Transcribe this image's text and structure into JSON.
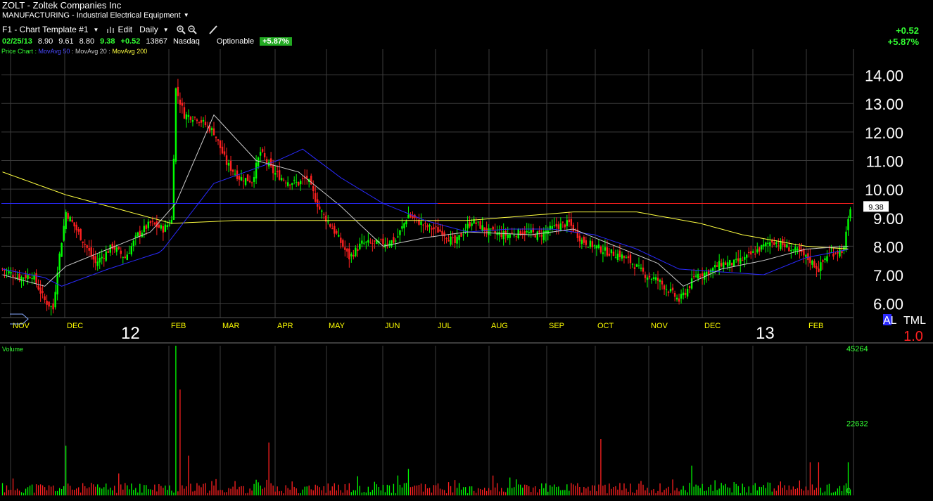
{
  "header": {
    "title": "ZOLT - Zoltek Companies Inc",
    "sector": "MANUFACTURING - Industrial Electrical Equipment",
    "toolbar": {
      "template": "F1 - Chart Template #1",
      "edit": "Edit",
      "period": "Daily"
    },
    "quote": {
      "date": "02/25/13",
      "open": "8.90",
      "high": "9.61",
      "low": "8.80",
      "last": "9.38",
      "change": "+0.52",
      "volume": "13867",
      "exchange": "Nasdaq",
      "optionable": "Optionable",
      "pct": "+5.87%"
    },
    "right_change": "+0.52",
    "right_pct": "+5.87%"
  },
  "legend": {
    "price_chart": "Price Chart :",
    "ma50": "MovAvg 50",
    "ma20": "MovAvg 20",
    "ma200": "MovAvg 200"
  },
  "colors": {
    "up": "#00ff00",
    "down": "#ff2020",
    "ma50": "#2a2aff",
    "ma20": "#c8c8c8",
    "ma200": "#ffff40",
    "grid": "#3c3c3c",
    "hline": "#2a2aff",
    "resist": "#ff2020",
    "axis_text": "#ffffff",
    "month_text": "#ffff00",
    "vol_label": "#33ff33"
  },
  "chart_data": [
    {
      "type": "candlestick",
      "title": "",
      "ylim": [
        5.5,
        14.9
      ],
      "yticks": [
        "14.00",
        "13.00",
        "12.00",
        "11.00",
        "10.00",
        "9.00",
        "8.00",
        "7.00",
        "6.00"
      ],
      "last_price_label": "9.38",
      "resistance_level": 9.5,
      "months": [
        "NOV",
        "DEC",
        "FEB",
        "MAR",
        "APR",
        "MAY",
        "JUN",
        "JUL",
        "AUG",
        "SEP",
        "OCT",
        "NOV",
        "DEC",
        "FEB"
      ],
      "years": [
        "12",
        "13"
      ],
      "corner_labels": {
        "al": "AL",
        "tml": "TML",
        "scale": "1.0"
      },
      "anchors": [
        [
          0,
          7.2
        ],
        [
          8,
          6.9
        ],
        [
          14,
          7.0
        ],
        [
          20,
          6.1
        ],
        [
          24,
          5.8
        ],
        [
          26,
          7.2
        ],
        [
          30,
          9.2
        ],
        [
          38,
          8.2
        ],
        [
          44,
          7.4
        ],
        [
          52,
          8.0
        ],
        [
          58,
          7.6
        ],
        [
          64,
          8.4
        ],
        [
          70,
          8.8
        ],
        [
          76,
          8.6
        ],
        [
          80,
          8.9
        ],
        [
          82,
          13.5
        ],
        [
          86,
          12.6
        ],
        [
          92,
          12.5
        ],
        [
          100,
          12.0
        ],
        [
          106,
          10.9
        ],
        [
          112,
          10.4
        ],
        [
          118,
          10.3
        ],
        [
          122,
          11.3
        ],
        [
          128,
          10.6
        ],
        [
          134,
          10.3
        ],
        [
          140,
          10.2
        ],
        [
          144,
          10.4
        ],
        [
          150,
          9.3
        ],
        [
          158,
          8.4
        ],
        [
          164,
          7.6
        ],
        [
          170,
          8.1
        ],
        [
          178,
          8.1
        ],
        [
          186,
          8.2
        ],
        [
          192,
          9.1
        ],
        [
          200,
          8.7
        ],
        [
          208,
          8.5
        ],
        [
          214,
          8.1
        ],
        [
          222,
          8.9
        ],
        [
          230,
          8.5
        ],
        [
          238,
          8.4
        ],
        [
          246,
          8.5
        ],
        [
          254,
          8.4
        ],
        [
          262,
          8.7
        ],
        [
          268,
          8.8
        ],
        [
          274,
          8.2
        ],
        [
          280,
          8.0
        ],
        [
          286,
          7.8
        ],
        [
          292,
          7.7
        ],
        [
          298,
          7.4
        ],
        [
          304,
          7.0
        ],
        [
          310,
          6.8
        ],
        [
          316,
          6.4
        ],
        [
          320,
          6.1
        ],
        [
          324,
          6.5
        ],
        [
          328,
          7.0
        ],
        [
          334,
          7.1
        ],
        [
          340,
          7.4
        ],
        [
          346,
          7.4
        ],
        [
          352,
          7.6
        ],
        [
          358,
          7.9
        ],
        [
          364,
          8.2
        ],
        [
          370,
          8.0
        ],
        [
          376,
          7.8
        ],
        [
          382,
          7.5
        ],
        [
          386,
          7.2
        ],
        [
          390,
          7.7
        ],
        [
          394,
          7.8
        ],
        [
          398,
          7.9
        ],
        [
          401,
          9.38
        ]
      ],
      "ma20": [
        [
          0,
          7.0
        ],
        [
          20,
          6.6
        ],
        [
          30,
          7.3
        ],
        [
          50,
          7.9
        ],
        [
          70,
          8.5
        ],
        [
          82,
          9.5
        ],
        [
          100,
          12.6
        ],
        [
          120,
          11.0
        ],
        [
          140,
          10.6
        ],
        [
          160,
          9.4
        ],
        [
          180,
          8.0
        ],
        [
          200,
          8.3
        ],
        [
          220,
          8.5
        ],
        [
          250,
          8.4
        ],
        [
          270,
          8.6
        ],
        [
          290,
          8.0
        ],
        [
          310,
          7.4
        ],
        [
          322,
          6.6
        ],
        [
          340,
          7.2
        ],
        [
          360,
          7.5
        ],
        [
          380,
          7.9
        ],
        [
          401,
          8.0
        ]
      ],
      "ma50": [
        [
          0,
          7.2
        ],
        [
          20,
          6.9
        ],
        [
          28,
          6.6
        ],
        [
          50,
          7.2
        ],
        [
          75,
          7.8
        ],
        [
          100,
          10.2
        ],
        [
          130,
          11.0
        ],
        [
          142,
          11.4
        ],
        [
          160,
          10.4
        ],
        [
          180,
          9.5
        ],
        [
          200,
          8.9
        ],
        [
          220,
          8.5
        ],
        [
          240,
          8.6
        ],
        [
          260,
          8.6
        ],
        [
          280,
          8.4
        ],
        [
          300,
          7.9
        ],
        [
          320,
          7.2
        ],
        [
          340,
          7.1
        ],
        [
          360,
          7.0
        ],
        [
          380,
          7.6
        ],
        [
          401,
          7.9
        ]
      ],
      "ma200": [
        [
          0,
          10.6
        ],
        [
          30,
          9.8
        ],
        [
          60,
          9.2
        ],
        [
          80,
          8.8
        ],
        [
          110,
          8.9
        ],
        [
          160,
          8.9
        ],
        [
          220,
          8.9
        ],
        [
          270,
          9.2
        ],
        [
          300,
          9.2
        ],
        [
          330,
          8.8
        ],
        [
          350,
          8.4
        ],
        [
          380,
          8.0
        ],
        [
          401,
          7.9
        ]
      ]
    },
    {
      "type": "bar",
      "title": "Volume",
      "ylim": [
        0,
        45264
      ],
      "yticks": [
        "45264",
        "22632",
        "0"
      ],
      "spikes": [
        [
          30,
          15000
        ],
        [
          82,
          45264
        ],
        [
          84,
          32000
        ],
        [
          88,
          12000
        ],
        [
          126,
          16000
        ],
        [
          192,
          8000
        ],
        [
          232,
          6000
        ],
        [
          283,
          17000
        ],
        [
          326,
          9000
        ],
        [
          382,
          10000
        ],
        [
          386,
          10000
        ],
        [
          400,
          10000
        ]
      ]
    }
  ]
}
